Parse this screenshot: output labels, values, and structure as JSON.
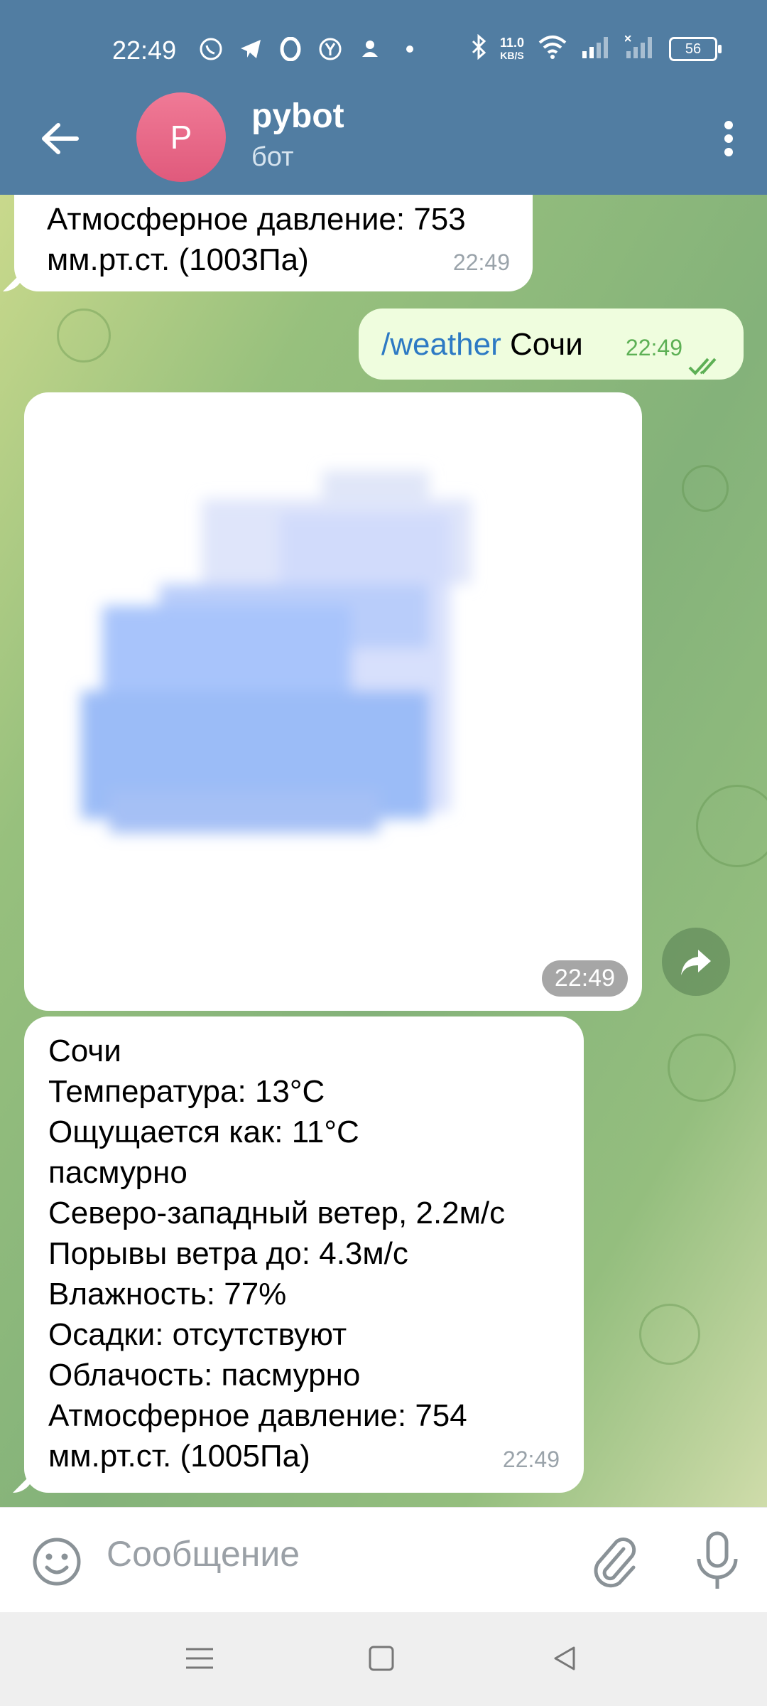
{
  "status_bar": {
    "time": "22:49",
    "net_speed_value": "11.0",
    "net_speed_unit": "KB/S",
    "battery": "56",
    "icons_left": [
      "viber-icon",
      "telegram-icon",
      "opera-icon",
      "yandex-icon",
      "person-icon",
      "dot-icon"
    ],
    "icons_right": [
      "bluetooth-icon",
      "wifi-icon",
      "signal-icon",
      "signal-off-icon",
      "battery-icon"
    ]
  },
  "header": {
    "avatar_letter": "P",
    "title": "pybot",
    "subtitle": "бот"
  },
  "messages": [
    {
      "type": "incoming_text",
      "lines": [
        "Атмосферное давление: 753",
        "мм.рт.ст. (1003Па)"
      ],
      "time": "22:49"
    },
    {
      "type": "outgoing_text",
      "command": "/weather",
      "text": "Сочи",
      "time": "22:49",
      "status": "read"
    },
    {
      "type": "incoming_photo",
      "image": "cloud-icon",
      "time": "22:49"
    },
    {
      "type": "incoming_text",
      "lines": [
        "Сочи",
        "Температура: 13°C",
        "Ощущается как: 11°C",
        "пасмурно",
        "Северо-западный ветер, 2.2м/с",
        "Порывы ветра до: 4.3м/с",
        "Влажность: 77%",
        "Осадки: отсутствуют",
        "Облачость: пасмурно",
        "Атмосферное давление: 754",
        "мм.рт.ст. (1005Па)"
      ],
      "time": "22:49"
    }
  ],
  "composer": {
    "placeholder": "Сообщение"
  },
  "colors": {
    "header_bg": "#517da2",
    "outgoing_bg": "#effdde",
    "command_link": "#2d7ac4",
    "read_check": "#5db055"
  }
}
